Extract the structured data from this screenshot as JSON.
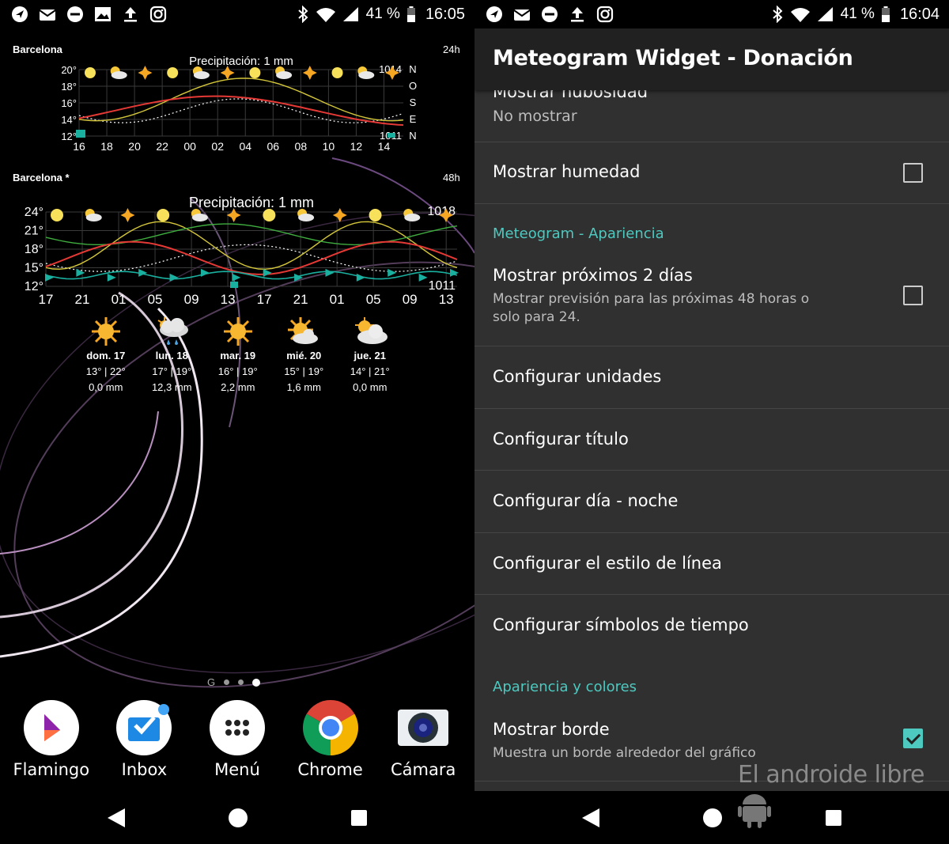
{
  "left": {
    "status": {
      "battery": "41 %",
      "time": "16:05"
    },
    "widget24": {
      "city": "Barcelona",
      "range": "24h",
      "precip_label": "Precipitación: 1 mm",
      "y_labels": [
        "20°",
        "18°",
        "16°",
        "14°",
        "12°"
      ],
      "x_labels": [
        "16",
        "18",
        "20",
        "22",
        "00",
        "02",
        "04",
        "06",
        "08",
        "10",
        "12",
        "14"
      ],
      "pressure_top": "1014",
      "pressure_bottom": "1011",
      "wind_labels": [
        "N",
        "O",
        "S",
        "E",
        "N"
      ]
    },
    "widget48": {
      "city": "Barcelona *",
      "range": "48h",
      "precip_label": "Precipitación: 1 mm",
      "y_labels": [
        "24°",
        "21°",
        "18°",
        "15°",
        "12°"
      ],
      "x_labels": [
        "17",
        "21",
        "01",
        "05",
        "09",
        "13",
        "17",
        "21",
        "01",
        "05",
        "09",
        "13"
      ],
      "pressure_top": "1018",
      "pressure_bottom": "1011"
    },
    "days": [
      {
        "name": "dom. 17",
        "temps": "13° | 22°",
        "rain": "0,0 mm",
        "icon": "sun-icon"
      },
      {
        "name": "lun. 18",
        "temps": "17° | 19°",
        "rain": "12,3 mm",
        "icon": "rain-cloud-icon"
      },
      {
        "name": "mar. 19",
        "temps": "16° | 19°",
        "rain": "2,2 mm",
        "icon": "sun-icon"
      },
      {
        "name": "mié. 20",
        "temps": "15° | 19°",
        "rain": "1,6 mm",
        "icon": "sun-cloud-icon"
      },
      {
        "name": "jue. 21",
        "temps": "14° | 21°",
        "rain": "0,0 mm",
        "icon": "sun-cloud-icon"
      }
    ],
    "page_indicator_g": "G",
    "dock": [
      {
        "label": "Flamingo",
        "icon": "flamingo-icon"
      },
      {
        "label": "Inbox",
        "icon": "inbox-icon"
      },
      {
        "label": "Menú",
        "icon": "app-drawer-icon"
      },
      {
        "label": "Chrome",
        "icon": "chrome-icon"
      },
      {
        "label": "Cámara",
        "icon": "camera-icon"
      }
    ]
  },
  "right": {
    "status": {
      "battery": "41 %",
      "time": "16:04"
    },
    "title": "Meteogram Widget - Donación",
    "partial_item": {
      "title": "Mostrar nubosidad",
      "summary": "No mostrar"
    },
    "show_humidity": {
      "title": "Mostrar humedad",
      "checked": false
    },
    "cat_appearance": "Meteogram - Apariencia",
    "next_two_days": {
      "title": "Mostrar próximos 2 días",
      "summary": "Mostrar previsión para las próximas 48 horas o solo para 24.",
      "checked": false
    },
    "menu_items": [
      "Configurar unidades",
      "Configurar título",
      "Configurar día - noche",
      "Configurar el estilo de línea",
      "Configurar símbolos de tiempo"
    ],
    "cat_colors": "Apariencia y colores",
    "show_border": {
      "title": "Mostrar borde",
      "summary": "Muestra un borde alrededor del gráfico",
      "checked": true
    },
    "watermark": "El androide libre"
  },
  "colors": {
    "accent": "#4ec9c0",
    "temp_line": "#e53935",
    "yellow_line": "#d4c63a",
    "green_line": "#3fae3f",
    "wind_marker": "#1ab0a0"
  }
}
